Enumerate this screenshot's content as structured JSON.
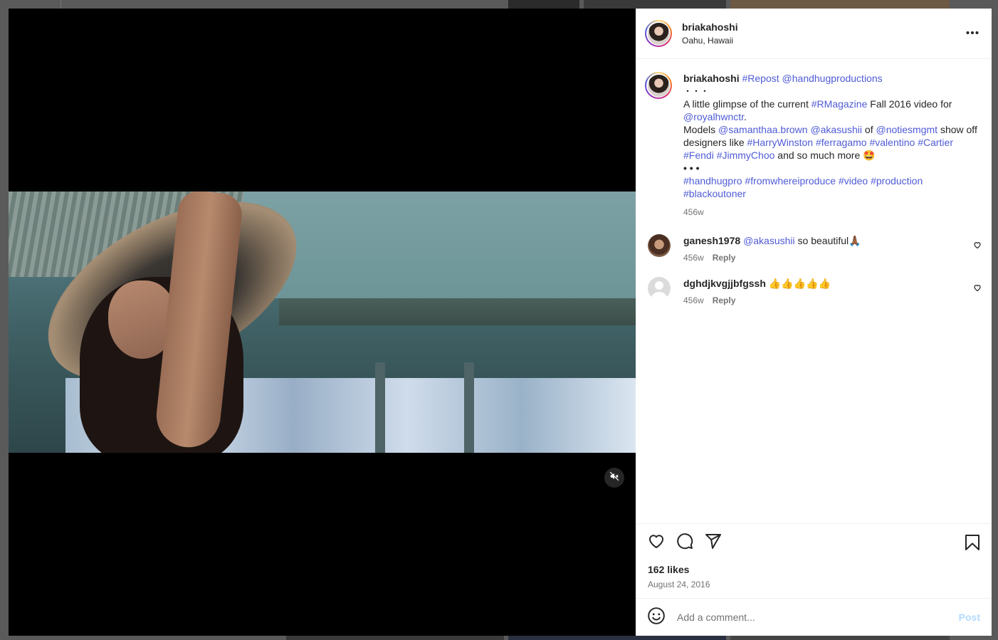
{
  "post": {
    "username": "briakahoshi",
    "location": "Oahu, Hawaii"
  },
  "caption": {
    "username": "briakahoshi",
    "tag_repost": "#Repost",
    "mention_handhug": "@handhugproductions",
    "dots1": "・・・",
    "line1_a": "A little glimpse of the current ",
    "tag_rmag": "#RMagazine",
    "line1_b": " Fall 2016 video for",
    "mention_royal": "@royalhwnctr",
    "period": ".",
    "models_a": "Models ",
    "mention_sam": "@samanthaa.brown",
    "mention_aka": "@akasushii",
    "of": " of ",
    "mention_noties": "@notiesmgmt",
    "show_off": " show off designers like ",
    "tag_harry": "#HarryWinston",
    "tag_ferragamo": "#ferragamo",
    "tag_valentino": "#valentino",
    "tag_cartier": "#Cartier",
    "tag_fendi": "#Fendi",
    "tag_jimmy": "#JimmyChoo",
    "so_much": " and so much more 🤩",
    "dots2": "• • •",
    "tag_handhugpro": "#handhugpro",
    "tag_fromwhere": "#fromwhereiproduce",
    "tag_video": "#video",
    "tag_production": "#production",
    "tag_blackout": "#blackoutoner",
    "time": "456w"
  },
  "comments": [
    {
      "username": "ganesh1978",
      "mention": "@akasushii",
      "text": " so beautiful🙏🏾",
      "time": "456w",
      "reply": "Reply"
    },
    {
      "username": "dghdjkvgjjbfgssh",
      "text": " 👍👍👍👍👍",
      "time": "456w",
      "reply": "Reply"
    }
  ],
  "stats": {
    "likes": "162 likes",
    "date": "August 24, 2016"
  },
  "add_comment": {
    "placeholder": "Add a comment...",
    "post_label": "Post"
  },
  "icons": {
    "more": "more-horizontal-icon",
    "mute": "muted-speaker-icon",
    "like": "heart-icon",
    "comment": "comment-bubble-icon",
    "share": "send-icon",
    "save": "bookmark-icon",
    "emoji": "emoji-smile-icon"
  },
  "colors": {
    "link": "#4f5bd5",
    "muted": "#737373",
    "post_disabled": "#b3dbff"
  }
}
